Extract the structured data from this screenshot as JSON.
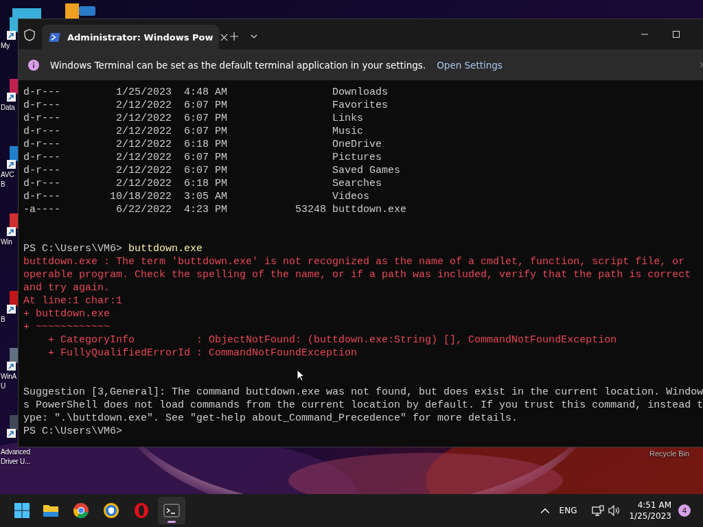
{
  "desktop": {
    "left_icons": [
      {
        "lines": [
          "My"
        ]
      },
      {
        "lines": [
          "Data"
        ]
      },
      {
        "lines": [
          "AVC",
          "B"
        ]
      },
      {
        "lines": [
          "Win"
        ]
      },
      {
        "lines": [
          "B"
        ]
      },
      {
        "lines": [
          "WinA",
          "U"
        ]
      },
      {
        "lines": [
          "Advanced",
          "Driver U..."
        ]
      }
    ],
    "right_icons": [
      {
        "lines": [
          "Recycle Bin"
        ]
      }
    ]
  },
  "window": {
    "tab": {
      "title": "Administrator: Windows Pow",
      "selected": true
    },
    "infobar": {
      "message": "Windows Terminal can be set as the default terminal application in your settings.",
      "link": "Open Settings"
    },
    "listing": [
      {
        "mode": "d-r---",
        "date": "1/25/2023",
        "time": "4:48 AM",
        "name": "Downloads"
      },
      {
        "mode": "d-r---",
        "date": "2/12/2022",
        "time": "6:07 PM",
        "name": "Favorites"
      },
      {
        "mode": "d-r---",
        "date": "2/12/2022",
        "time": "6:07 PM",
        "name": "Links"
      },
      {
        "mode": "d-r---",
        "date": "2/12/2022",
        "time": "6:07 PM",
        "name": "Music"
      },
      {
        "mode": "d-r---",
        "date": "2/12/2022",
        "time": "6:18 PM",
        "name": "OneDrive"
      },
      {
        "mode": "d-r---",
        "date": "2/12/2022",
        "time": "6:07 PM",
        "name": "Pictures"
      },
      {
        "mode": "d-r---",
        "date": "2/12/2022",
        "time": "6:07 PM",
        "name": "Saved Games"
      },
      {
        "mode": "d-r---",
        "date": "2/12/2022",
        "time": "6:18 PM",
        "name": "Searches"
      },
      {
        "mode": "d-r---",
        "date": "10/18/2022",
        "time": "3:05 AM",
        "name": "Videos"
      },
      {
        "mode": "-a----",
        "date": "6/22/2022",
        "time": "4:23 PM",
        "length": "53248",
        "name": "buttdown.exe"
      }
    ],
    "output": [
      {
        "kind": "blank"
      },
      {
        "kind": "blank"
      },
      {
        "kind": "prompt",
        "prompt": "PS C:\\Users\\VM6>",
        "command": "buttdown.exe"
      },
      {
        "kind": "error",
        "text": "buttdown.exe : The term 'buttdown.exe' is not recognized as the name of a cmdlet, function, script file, or"
      },
      {
        "kind": "error",
        "text": "operable program. Check the spelling of the name, or if a path was included, verify that the path is correct"
      },
      {
        "kind": "error",
        "text": "and try again."
      },
      {
        "kind": "error",
        "text": "At line:1 char:1"
      },
      {
        "kind": "error",
        "text": "+ buttdown.exe"
      },
      {
        "kind": "error",
        "text": "+ ~~~~~~~~~~~~"
      },
      {
        "kind": "error",
        "text": "    + CategoryInfo          : ObjectNotFound: (buttdown.exe:String) [], CommandNotFoundException"
      },
      {
        "kind": "error",
        "text": "    + FullyQualifiedErrorId : CommandNotFoundException"
      },
      {
        "kind": "blank"
      },
      {
        "kind": "blank"
      },
      {
        "kind": "text",
        "text": "Suggestion [3,General]: The command buttdown.exe was not found, but does exist in the current location. Window"
      },
      {
        "kind": "text",
        "text": "s PowerShell does not load commands from the current location by default. If you trust this command, instead t"
      },
      {
        "kind": "text",
        "text": "ype: \".\\buttdown.exe\". See \"get-help about_Command_Precedence\" for more details."
      },
      {
        "kind": "prompt",
        "prompt": "PS C:\\Users\\VM6>"
      }
    ]
  },
  "taskbar": {
    "apps": [
      {
        "kind": "explorer",
        "selected": false
      },
      {
        "kind": "chrome",
        "selected": false
      },
      {
        "kind": "brave",
        "selected": false
      },
      {
        "kind": "opera",
        "selected": false
      },
      {
        "kind": "terminal",
        "selected": true
      }
    ],
    "language": "ENG",
    "time": "4:51 AM",
    "date": "1/25/2023",
    "notifications": "4"
  }
}
